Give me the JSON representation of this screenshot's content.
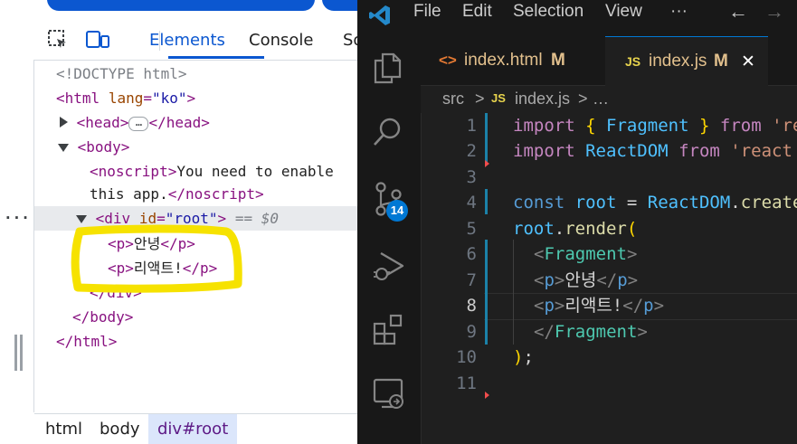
{
  "devtools": {
    "tabs": [
      "Elements",
      "Console",
      "So"
    ],
    "active_tab": "Elements",
    "dom_lines": {
      "doctype": "<!DOCTYPE html>",
      "html_open_tag": "html",
      "html_lang_attr": "lang",
      "html_lang_value": "\"ko\"",
      "head_open": "<head>",
      "head_close": "</head>",
      "head_collapsed": "…",
      "body_open": "<body>",
      "noscript_open": "<noscript>",
      "noscript_text_1": "You need to enable",
      "noscript_text_2": "this app.",
      "noscript_close": "</noscript>",
      "div_tag": "div",
      "div_id_attr": "id",
      "div_id_value": "\"root\"",
      "div_eq": "== $0",
      "row_menu": "···",
      "p_open": "<p>",
      "p_close": "</p>",
      "p1_text": "안녕",
      "p2_text": "리액트!",
      "div_close": "</div>",
      "body_close": "</body>",
      "html_close": "</html>"
    },
    "breadcrumbs": [
      "html",
      "body",
      "div#root"
    ],
    "active_crumb": "div#root",
    "highlight_color": "#f6e200"
  },
  "vscode": {
    "menu": [
      "File",
      "Edit",
      "Selection",
      "View",
      "···"
    ],
    "nav_back": "←",
    "nav_forward": "→",
    "tabs": [
      {
        "icon": "<>",
        "label": "index.html",
        "badge": "M",
        "active": false
      },
      {
        "icon": "JS",
        "label": "index.js",
        "badge": "M",
        "active": true,
        "close": "✕"
      }
    ],
    "breadcrumb": {
      "folder": "src",
      "sep": ">",
      "icon": "JS",
      "file": "index.js",
      "more": "…"
    },
    "source_control_badge": "14",
    "current_line": "8",
    "line_numbers": [
      "1",
      "2",
      "3",
      "4",
      "5",
      "6",
      "7",
      "8",
      "9",
      "10",
      "11"
    ],
    "code": {
      "l1_import": "import",
      "l1_lb": "{",
      "l1_fragment": "Fragment",
      "l1_rb": "}",
      "l1_from": "from",
      "l1_src": "'re",
      "l2_import": "import",
      "l2_reactdom": "ReactDOM",
      "l2_from": "from",
      "l2_src": "'react",
      "l4_const": "const",
      "l4_root": "root",
      "l4_eq": "=",
      "l4_reactdom": "ReactDOM",
      "l4_dot": ".",
      "l4_create": "create",
      "l5_root": "root",
      "l5_dot": ".",
      "l5_render": "render",
      "l5_paren": "(",
      "l6_open": "<",
      "l6_fragment": "Fragment",
      "l6_close": ">",
      "l7_p_open_lt": "<",
      "l7_p": "p",
      "l7_gt": ">",
      "l7_text": "안녕",
      "l7_close_lt": "</",
      "l7_close_p": "p",
      "l7_close_gt": ">",
      "l8_p_open_lt": "<",
      "l8_p": "p",
      "l8_gt": ">",
      "l8_text": "리액트!",
      "l8_close_lt": "</",
      "l8_close_p": "p",
      "l8_close_gt": ">",
      "l9_open": "</",
      "l9_fragment": "Fragment",
      "l9_close": ">",
      "l10_paren": ")",
      "l10_semi": ";"
    }
  }
}
